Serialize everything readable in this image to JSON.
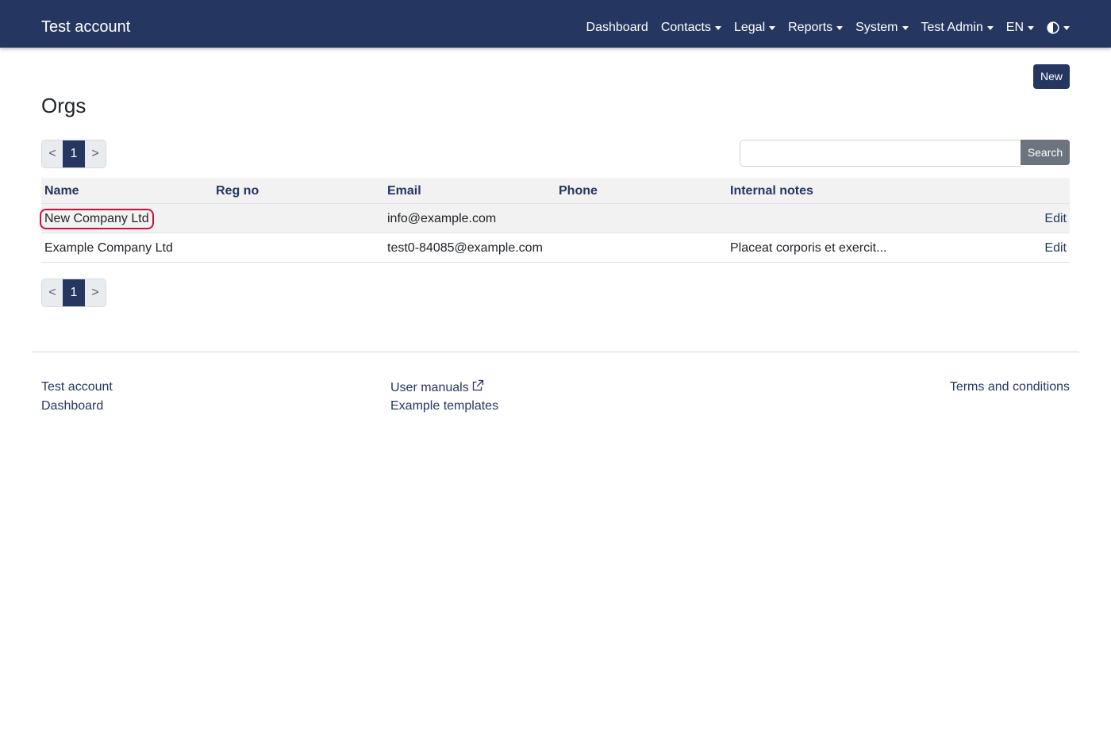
{
  "navbar": {
    "brand": "Test account",
    "items": [
      {
        "label": "Dashboard",
        "dropdown": false
      },
      {
        "label": "Contacts",
        "dropdown": true
      },
      {
        "label": "Legal",
        "dropdown": true
      },
      {
        "label": "Reports",
        "dropdown": true
      },
      {
        "label": "System",
        "dropdown": true
      },
      {
        "label": "Test Admin",
        "dropdown": true
      },
      {
        "label": "EN",
        "dropdown": true
      }
    ],
    "theme_icon": "contrast-half-circle-icon"
  },
  "page": {
    "new_button": "New",
    "title": "Orgs"
  },
  "pagination": {
    "prev": "<",
    "current": "1",
    "next": ">"
  },
  "search": {
    "value": "",
    "placeholder": "",
    "button": "Search"
  },
  "table": {
    "columns": [
      "Name",
      "Reg no",
      "Email",
      "Phone",
      "Internal notes"
    ],
    "rows": [
      {
        "name": "New Company Ltd",
        "reg_no": "",
        "email": "info@example.com",
        "phone": "",
        "notes": "",
        "action": "Edit"
      },
      {
        "name": "Example Company Ltd",
        "reg_no": "",
        "email": "test0-84085@example.com",
        "phone": "",
        "notes": "Placeat corporis et exercit...",
        "action": "Edit"
      }
    ]
  },
  "footer": {
    "col1": [
      "Test account",
      "Dashboard"
    ],
    "col2": [
      "User manuals",
      "Example templates"
    ],
    "col3": [
      "Terms and conditions"
    ]
  },
  "colors": {
    "brand": "#253761",
    "secondary": "#6c757d",
    "highlight": "#d0103a"
  }
}
